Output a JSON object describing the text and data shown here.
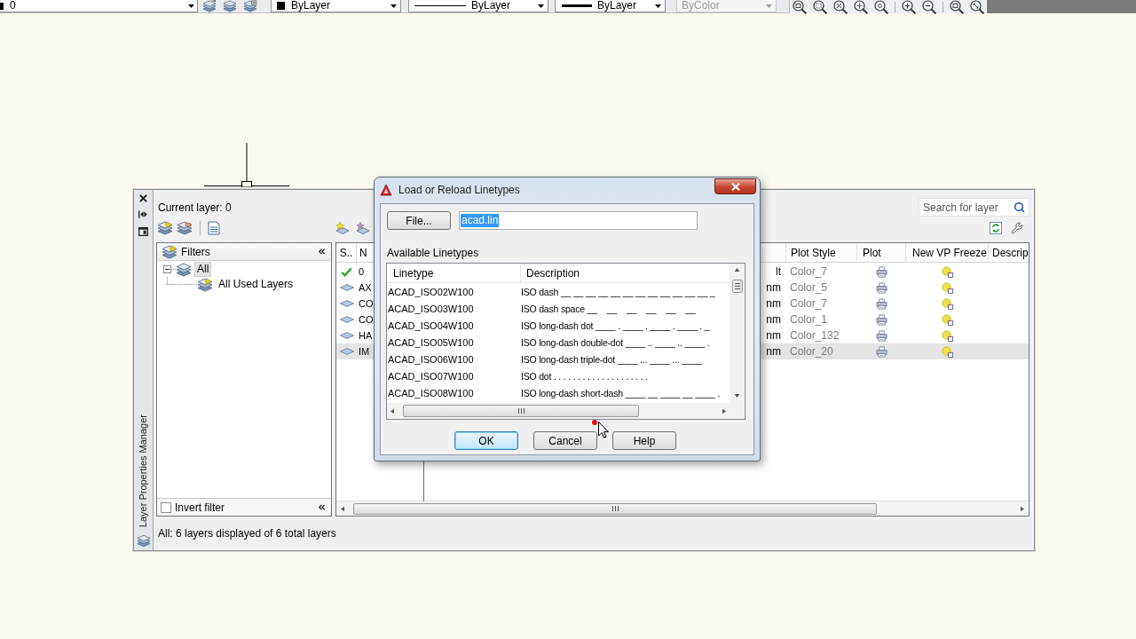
{
  "toolbar": {
    "layer_dropdown": {
      "value": "0"
    },
    "property_dropdowns": [
      {
        "kind": "color",
        "value": "ByLayer",
        "disabled": false
      },
      {
        "kind": "linetype",
        "value": "ByLayer",
        "disabled": false
      },
      {
        "kind": "lineweight",
        "value": "ByLayer",
        "disabled": false
      },
      {
        "kind": "plotstyle",
        "value": "ByColor",
        "disabled": true
      }
    ]
  },
  "palette": {
    "title": "Layer Properties Manager",
    "current_layer": "Current layer: 0",
    "search": {
      "placeholder": "Search for layer"
    },
    "filters": {
      "title": "Filters",
      "tree": [
        {
          "label": "All",
          "expanded": true,
          "selected": true,
          "children": [
            {
              "label": "All Used Layers",
              "selected": false
            }
          ]
        }
      ],
      "invert_filter": {
        "label": "Invert filter",
        "checked": false
      }
    },
    "table": {
      "columns": [
        {
          "label": "S.."
        },
        {
          "label": "N"
        },
        {
          "label": "Plot Style"
        },
        {
          "label": "Plot"
        },
        {
          "label": "New VP Freeze"
        },
        {
          "label": "Descrip"
        }
      ],
      "rows": [
        {
          "current": true,
          "name": "0",
          "column_3": "lt",
          "plot_style": "Color_7",
          "selected": false
        },
        {
          "current": false,
          "name": "AX",
          "column_3": "nm",
          "plot_style": "Color_5",
          "selected": false
        },
        {
          "current": false,
          "name": "CO",
          "column_3": "nm",
          "plot_style": "Color_7",
          "selected": false
        },
        {
          "current": false,
          "name": "CO",
          "column_3": "nm",
          "plot_style": "Color_1",
          "selected": false
        },
        {
          "current": false,
          "name": "HA",
          "column_3": "nm",
          "plot_style": "Color_132",
          "selected": false
        },
        {
          "current": false,
          "name": "IM",
          "column_3": "nm",
          "plot_style": "Color_20",
          "selected": true
        }
      ]
    },
    "status_bar": "All: 6 layers displayed of 6 total layers"
  },
  "dialog": {
    "title": "Load or Reload Linetypes",
    "file_button": "File...",
    "file_field": {
      "value": "acad.lin",
      "text_selected": true
    },
    "list_label": "Available Linetypes",
    "list": {
      "columns": [
        "Linetype",
        "Description"
      ],
      "rows": [
        {
          "linetype": "ACAD_ISO02W100",
          "description": "ISO dash __ __ __ __ __ __ __ __ __ __ __ __ _",
          "selected": false
        },
        {
          "linetype": "ACAD_ISO03W100",
          "description": "ISO dash space __    __    __    __    __    __",
          "selected": false
        },
        {
          "linetype": "ACAD_ISO04W100",
          "description": "ISO long-dash dot ____ . ____ . ____ . ____ . _",
          "selected": false
        },
        {
          "linetype": "ACAD_ISO05W100",
          "description": "ISO long-dash double-dot ____ .. ____ .. ____ .",
          "selected": false
        },
        {
          "linetype": "ACAD_ISO06W100",
          "description": "ISO long-dash triple-dot ____ ... ____ ... ____",
          "selected": false
        },
        {
          "linetype": "ACAD_ISO07W100",
          "description": "ISO dot . . . . . . . . . . . . . . . . . . . .",
          "selected": false
        },
        {
          "linetype": "ACAD_ISO08W100",
          "description": "ISO long-dash short-dash ____ __ ____ __ ____ .",
          "selected": false
        }
      ]
    },
    "buttons": [
      {
        "label": "OK",
        "default": true
      },
      {
        "label": "Cancel",
        "default": false
      },
      {
        "label": "Help",
        "default": false
      }
    ]
  }
}
